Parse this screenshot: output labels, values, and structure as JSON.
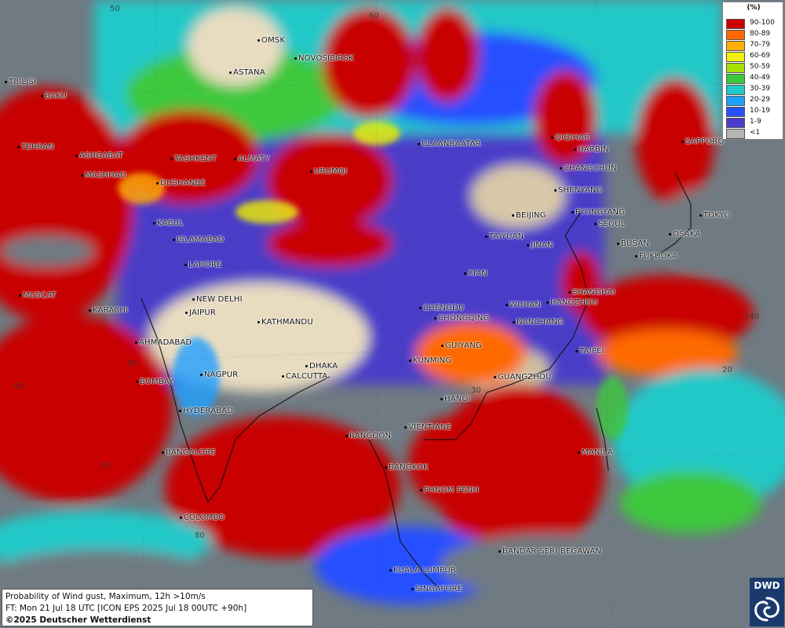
{
  "legend": {
    "unit": "(%)",
    "items": [
      {
        "label": "90-100",
        "color": "#c80000"
      },
      {
        "label": "80-89",
        "color": "#ff6a00"
      },
      {
        "label": "70-79",
        "color": "#ffb000"
      },
      {
        "label": "60-69",
        "color": "#f0f000"
      },
      {
        "label": "50-59",
        "color": "#a8e000"
      },
      {
        "label": "40-49",
        "color": "#3cc83c"
      },
      {
        "label": "30-39",
        "color": "#20c8c8"
      },
      {
        "label": "20-29",
        "color": "#20a0ff"
      },
      {
        "label": "10-19",
        "color": "#2850ff"
      },
      {
        "label": "1-9",
        "color": "#4a3cc8"
      },
      {
        "label": "<1",
        "color": "#b4b4b4"
      }
    ]
  },
  "info": {
    "line1": "Probability of Wind gust, Maximum, 12h >10m/s",
    "line2": "FT: Mon 21 Jul 18 UTC [ICON EPS 2025 Jul 18 00UTC +90h]",
    "line3": "©2025 Deutscher Wetterdienst"
  },
  "logo": {
    "text": "DWD"
  },
  "grid_labels": [
    "50",
    "60",
    "20",
    "10",
    "60",
    "80",
    "140",
    "20",
    "30"
  ],
  "cities": [
    "OMSK",
    "NOVOSIBIRSK",
    "ASTANA",
    "TBILISI",
    "BAKU",
    "TEHRAN",
    "ASHGABAT",
    "MASHHAD",
    "TASHKENT",
    "ALMATY",
    "DUSHANBE",
    "URUMQI",
    "ULAANBAATAR",
    "QIQIHAR",
    "HARBIN",
    "SAPPORO",
    "CHANGCHUN",
    "SHENYANG",
    "BEIJING",
    "PYONGYANG",
    "SEOUL",
    "TOKYO",
    "OSAKA",
    "BUSAN",
    "FUKUOKA",
    "TAIYUAN",
    "JINAN",
    "KABUL",
    "ISLAMABAD",
    "LAHORE",
    "XIAN",
    "SHANGHAI",
    "MUSCAT",
    "NEW DELHI",
    "HANGZHOU",
    "CHENGDU",
    "WUHAN",
    "KARACHI",
    "JAIPUR",
    "KATHMANDU",
    "CHONGQING",
    "NANCHANG",
    "AHMADABAD",
    "GUIYANG",
    "TAIPEI",
    "KUNMING",
    "DHAKA",
    "NAGPUR",
    "CALCUTTA",
    "BOMBAY",
    "GUANGZHOU",
    "HANOI",
    "HYDERABAD",
    "RANGOON",
    "VIENTIANE",
    "BANGALORE",
    "MANILA",
    "BANGKOK",
    "PHNOM PENH",
    "COLOMBO",
    "BANDAR SERI BEGAWAN",
    "KUALA LUMPUR",
    "SINGAPORE"
  ]
}
